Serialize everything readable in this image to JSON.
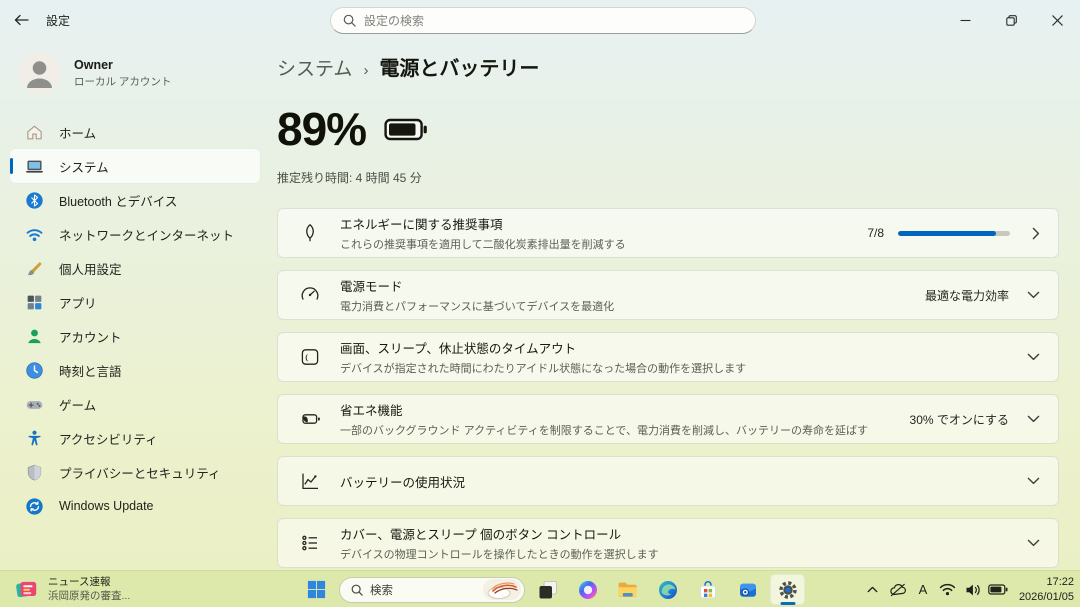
{
  "window": {
    "title": "設定",
    "search_placeholder": "設定の検索"
  },
  "account": {
    "name": "Owner",
    "type": "ローカル アカウント"
  },
  "sidebar": {
    "items": [
      {
        "label": "ホーム",
        "icon": "home-icon",
        "selected": false
      },
      {
        "label": "システム",
        "icon": "system-icon",
        "selected": true
      },
      {
        "label": "Bluetooth とデバイス",
        "icon": "bluetooth-icon",
        "selected": false
      },
      {
        "label": "ネットワークとインターネット",
        "icon": "network-icon",
        "selected": false
      },
      {
        "label": "個人用設定",
        "icon": "personalization-icon",
        "selected": false
      },
      {
        "label": "アプリ",
        "icon": "apps-icon",
        "selected": false
      },
      {
        "label": "アカウント",
        "icon": "accounts-icon",
        "selected": false
      },
      {
        "label": "時刻と言語",
        "icon": "time-language-icon",
        "selected": false
      },
      {
        "label": "ゲーム",
        "icon": "gaming-icon",
        "selected": false
      },
      {
        "label": "アクセシビリティ",
        "icon": "accessibility-icon",
        "selected": false
      },
      {
        "label": "プライバシーとセキュリティ",
        "icon": "privacy-icon",
        "selected": false
      },
      {
        "label": "Windows Update",
        "icon": "windows-update-icon",
        "selected": false
      }
    ]
  },
  "breadcrumb": {
    "parent": "システム",
    "separator": "›",
    "current": "電源とバッテリー"
  },
  "battery": {
    "percent": "89%",
    "estimate": "推定残り時間: 4 時間 45 分"
  },
  "cards": [
    {
      "icon": "leaf-icon",
      "title": "エネルギーに関する推奨事項",
      "subtitle": "これらの推奨事項を適用して二酸化炭素排出量を削減する",
      "badge": "7/8",
      "progress_pct": "87.5%",
      "chevron": "right"
    },
    {
      "icon": "power-mode-icon",
      "title": "電源モード",
      "subtitle": "電力消費とパフォーマンスに基づいてデバイスを最適化",
      "value": "最適な電力効率",
      "chevron": "down"
    },
    {
      "icon": "screen-sleep-icon",
      "title": "画面、スリープ、休止状態のタイムアウト",
      "subtitle": "デバイスが指定された時間にわたりアイドル状態になった場合の動作を選択します",
      "value": "",
      "chevron": "down"
    },
    {
      "icon": "energy-saver-icon",
      "title": "省エネ機能",
      "subtitle": "一部のバックグラウンド アクティビティを制限することで、電力消費を削減し、バッテリーの寿命を延ばす",
      "value": "30% でオンにする",
      "chevron": "down"
    },
    {
      "icon": "battery-usage-icon",
      "title": "バッテリーの使用状況",
      "subtitle": "",
      "value": "",
      "chevron": "down"
    },
    {
      "icon": "lid-buttons-icon",
      "title": "カバー、電源とスリープ 個のボタン コントロール",
      "subtitle": "デバイスの物理コントロールを操作したときの動作を選択します",
      "value": "",
      "chevron": "down"
    }
  ],
  "taskbar": {
    "widgets": {
      "title": "ニュース速報",
      "subtitle": "浜岡原発の審査..."
    },
    "search_label": "検索",
    "apps": [
      "start",
      "task-view",
      "copilot",
      "file-explorer",
      "edge",
      "microsoft-store",
      "outlook",
      "settings"
    ],
    "active_app": "settings",
    "ime": "A",
    "clock": {
      "time": "17:22",
      "date": "2026/01/05"
    }
  },
  "colors": {
    "accent": "#0067c0",
    "progress_track": "#c6c9bc",
    "taskbar_bg": "#dde8ab"
  }
}
